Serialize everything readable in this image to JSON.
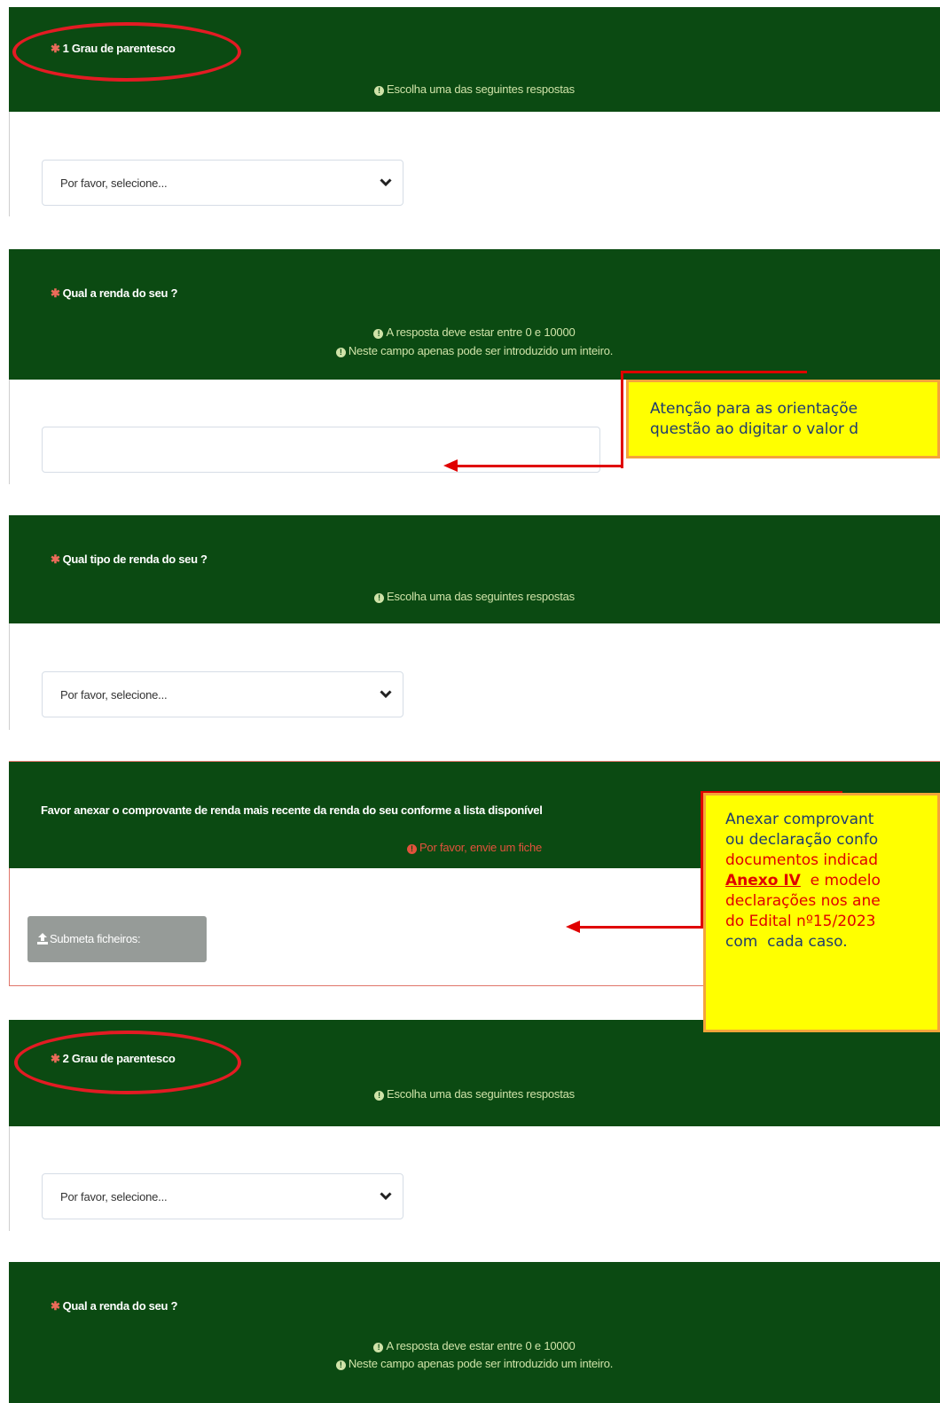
{
  "colors": {
    "header_green": "#0b4a12",
    "hint_text": "#cfe3a8",
    "error_text": "#e2523c",
    "asterisk": "#ec6b5a",
    "callout_bg": "#ffff00",
    "callout_border": "#f5a43a",
    "annotation_red": "#e31b23"
  },
  "q1": {
    "title": "1 Grau de parentesco",
    "hint": "Escolha uma das seguintes respostas",
    "select_value": "Por favor, selecione..."
  },
  "q2": {
    "title": "Qual a renda do seu ?",
    "hint1": "A resposta deve estar entre 0 e 10000",
    "hint2": "Neste campo apenas pode ser introduzido um inteiro.",
    "input_value": ""
  },
  "q3": {
    "title": "Qual tipo de renda do seu ?",
    "hint": "Escolha uma das seguintes respostas",
    "select_value": "Por favor, selecione..."
  },
  "q4": {
    "title": "Favor anexar o comprovante de renda mais recente da renda do seu conforme a lista disponível",
    "error": "Por favor, envie um fiche",
    "upload_label": "Submeta ficheiros:"
  },
  "q5": {
    "title": "2 Grau de parentesco",
    "hint": "Escolha uma das seguintes respostas",
    "select_value": "Por favor, selecione..."
  },
  "q6": {
    "title": "Qual a renda do seu ?",
    "hint1": "A resposta deve estar entre 0 e 10000",
    "hint2": "Neste campo apenas pode ser introduzido um inteiro."
  },
  "callout1": {
    "line1": "Atenção para as orientaçõe",
    "line2": "questão ao digitar o valor d"
  },
  "callout2": {
    "line1": "Anexar comprovant",
    "line2": "ou declaração confo",
    "line3": "documentos indicad",
    "line4_link": "Anexo IV",
    "line4_rest": "  e modelo",
    "line5": "declarações nos ane",
    "line6": "do Edital nº15/2023",
    "line7": "com  cada caso."
  },
  "icons": {
    "required": "asterisk-icon",
    "info": "exclamation-circle-icon",
    "dropdown": "chevron-down-icon",
    "upload": "upload-icon"
  }
}
